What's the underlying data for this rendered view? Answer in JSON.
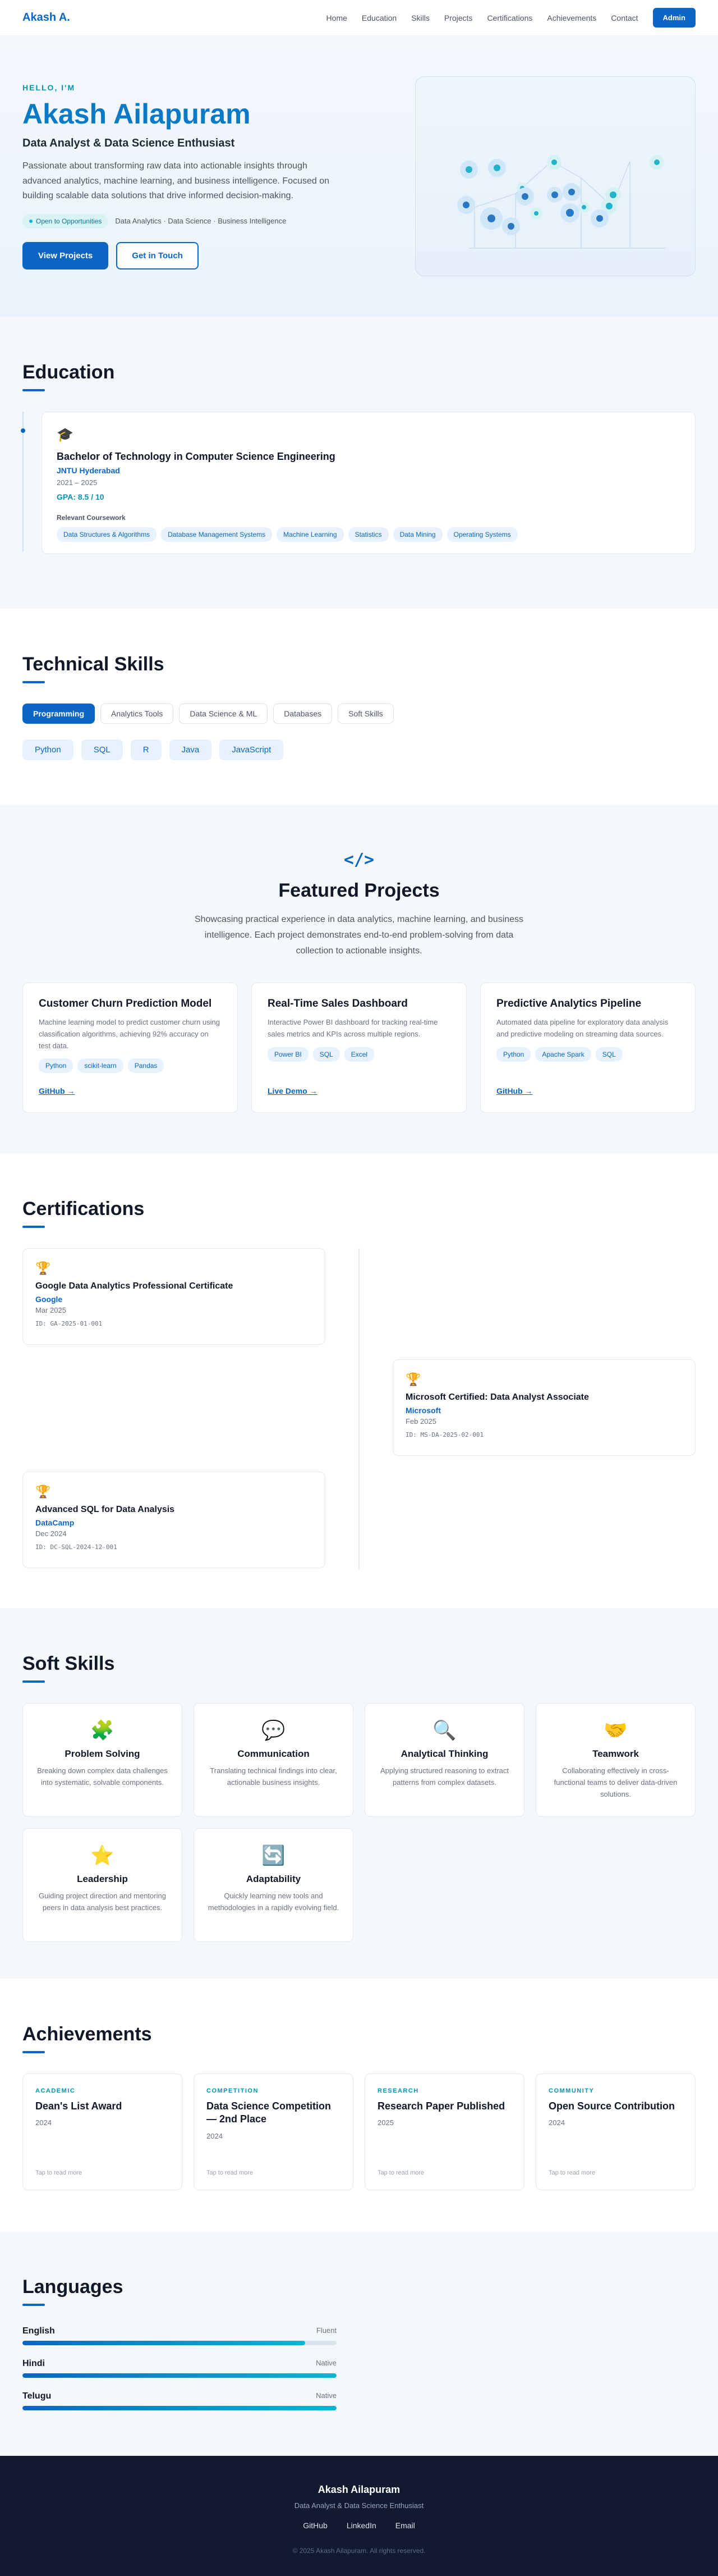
{
  "nav": {
    "brand": "Akash A.",
    "links": [
      "Home",
      "Education",
      "Skills",
      "Projects",
      "Certifications",
      "Achievements",
      "Contact"
    ],
    "admin_label": "Admin"
  },
  "hero": {
    "greeting": "HELLO, I'M",
    "name": "Akash Ailapuram",
    "subtitle": "Data Analyst & Data Science Enthusiast",
    "description": "Passionate about transforming raw data into actionable insights through advanced analytics, machine learning, and business intelligence. Focused on building scalable data solutions that drive informed decision-making.",
    "status": "Open to Opportunities",
    "focus": "Data Analytics · Data Science · Business Intelligence",
    "primary_cta": "View Projects",
    "secondary_cta": "Get in Touch"
  },
  "education": {
    "title": "Education",
    "degree": "Bachelor of Technology in Computer Science Engineering",
    "school": "JNTU Hyderabad",
    "years": "2021 – 2025",
    "gpa": "GPA: 8.5 / 10",
    "coursework_label": "Relevant Coursework",
    "coursework": [
      "Data Structures & Algorithms",
      "Database Management Systems",
      "Machine Learning",
      "Statistics",
      "Data Mining",
      "Operating Systems"
    ]
  },
  "skills": {
    "title": "Technical Skills",
    "tabs": [
      "Programming",
      "Analytics Tools",
      "Data Science & ML",
      "Databases",
      "Soft Skills"
    ],
    "active_tab": "Programming",
    "items": [
      "Python",
      "SQL",
      "R",
      "Java",
      "JavaScript"
    ]
  },
  "projects": {
    "icon_text": "</>",
    "title": "Featured Projects",
    "description": "Showcasing practical experience in data analytics, machine learning, and business intelligence. Each project demonstrates end-to-end problem-solving from data collection to actionable insights.",
    "cards": [
      {
        "title": "Customer Churn Prediction Model",
        "desc": "Machine learning model to predict customer churn using classification algorithms, achieving 92% accuracy on test data.",
        "tags": [
          "Python",
          "scikit-learn",
          "Pandas"
        ],
        "link": "GitHub →"
      },
      {
        "title": "Real-Time Sales Dashboard",
        "desc": "Interactive Power BI dashboard for tracking real-time sales metrics and KPIs across multiple regions.",
        "tags": [
          "Power BI",
          "SQL",
          "Excel"
        ],
        "link": "Live Demo →"
      },
      {
        "title": "Predictive Analytics Pipeline",
        "desc": "Automated data pipeline for exploratory data analysis and predictive modeling on streaming data sources.",
        "tags": [
          "Python",
          "Apache Spark",
          "SQL"
        ],
        "link": "GitHub →"
      }
    ]
  },
  "certifications": {
    "title": "Certifications",
    "items": [
      {
        "name": "Google Data Analytics Professional Certificate",
        "org": "Google",
        "date": "Mar 2025",
        "id": "ID: GA-2025-01-001"
      },
      {
        "name": "Microsoft Certified: Data Analyst Associate",
        "org": "Microsoft",
        "date": "Feb 2025",
        "id": "ID: MS-DA-2025-02-001"
      },
      {
        "name": "Advanced SQL for Data Analysis",
        "org": "DataCamp",
        "date": "Dec 2024",
        "id": "ID: DC-SQL-2024-12-001"
      }
    ]
  },
  "soft_skills": {
    "title": "Soft Skills",
    "items": [
      {
        "icon": "puzzle-icon",
        "glyph": "🧩",
        "title": "Problem Solving",
        "desc": "Breaking down complex data challenges into systematic, solvable components."
      },
      {
        "icon": "speech-icon",
        "glyph": "💬",
        "title": "Communication",
        "desc": "Translating technical findings into clear, actionable business insights."
      },
      {
        "icon": "magnifier-icon",
        "glyph": "🔍",
        "title": "Analytical Thinking",
        "desc": "Applying structured reasoning to extract patterns from complex datasets."
      },
      {
        "icon": "handshake-icon",
        "glyph": "🤝",
        "title": "Teamwork",
        "desc": "Collaborating effectively in cross-functional teams to deliver data-driven solutions."
      },
      {
        "icon": "star-icon",
        "glyph": "⭐",
        "title": "Leadership",
        "desc": "Guiding project direction and mentoring peers in data analysis best practices."
      },
      {
        "icon": "refresh-icon",
        "glyph": "🔄",
        "title": "Adaptability",
        "desc": "Quickly learning new tools and methodologies in a rapidly evolving field."
      }
    ]
  },
  "achievements": {
    "title": "Achievements",
    "items": [
      {
        "category": "ACADEMIC",
        "title": "Dean's List Award",
        "year": "2024",
        "hint": "Tap to read more"
      },
      {
        "category": "COMPETITION",
        "title": "Data Science Competition — 2nd Place",
        "year": "2024",
        "hint": "Tap to read more"
      },
      {
        "category": "RESEARCH",
        "title": "Research Paper Published",
        "year": "2025",
        "hint": "Tap to read more"
      },
      {
        "category": "COMMUNITY",
        "title": "Open Source Contribution",
        "year": "2024",
        "hint": "Tap to read more"
      }
    ]
  },
  "languages": {
    "title": "Languages",
    "items": [
      {
        "name": "English",
        "level": "Fluent",
        "proficiency": 0.9
      },
      {
        "name": "Hindi",
        "level": "Native",
        "proficiency": 1.0
      },
      {
        "name": "Telugu",
        "level": "Native",
        "proficiency": 1.0
      }
    ]
  },
  "footer": {
    "name": "Akash Ailapuram",
    "subtitle": "Data Analyst & Data Science Enthusiast",
    "links": [
      "GitHub",
      "LinkedIn",
      "Email"
    ],
    "copyright": "© 2025 Akash Ailapuram. All rights reserved."
  },
  "colors": {
    "primary": "#0a66c2",
    "accent": "#0891b2",
    "footer_bg": "#111a2e"
  }
}
